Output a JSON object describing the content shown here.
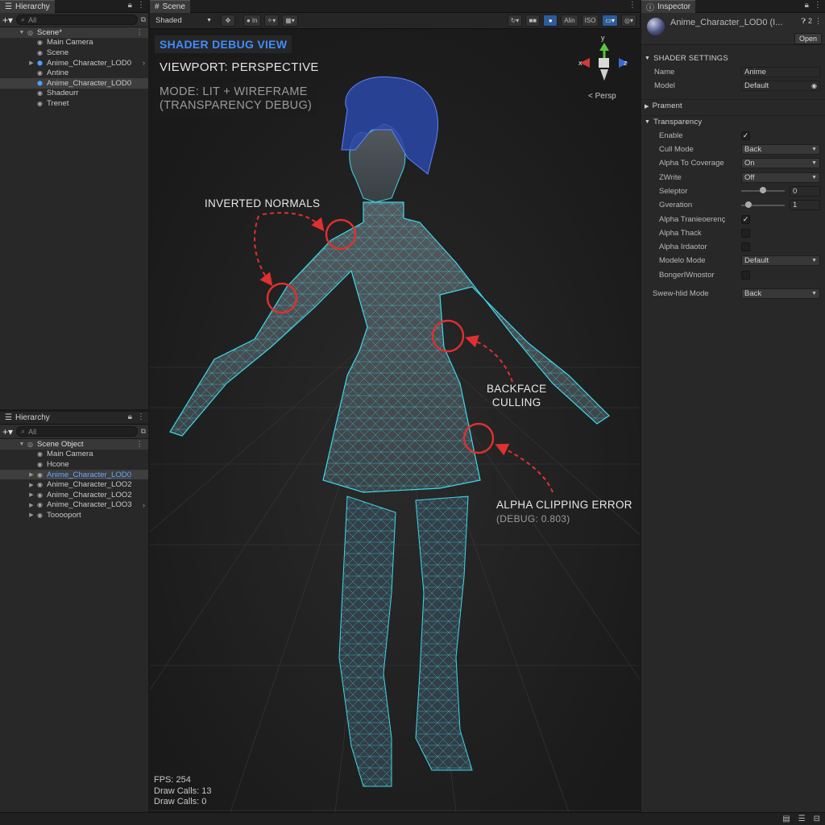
{
  "hierarchy_top": {
    "tab_label": "Hierarchy",
    "search_placeholder": "All",
    "items": [
      {
        "label": "Scene*",
        "icon": "scene-icon"
      },
      {
        "label": "Main Camera",
        "icon": "camera-icon"
      },
      {
        "label": "Scene",
        "icon": "object-icon"
      },
      {
        "label": "Anime_Character_LOD0",
        "icon": "prefab-icon"
      },
      {
        "label": "Antine",
        "icon": "object-icon"
      },
      {
        "label": "Anime_Character_LOD0",
        "icon": "prefab-icon"
      },
      {
        "label": "Shadeurr",
        "icon": "object-icon"
      },
      {
        "label": "Trenet",
        "icon": "object-icon"
      }
    ]
  },
  "hierarchy_bottom": {
    "tab_label": "Hierarchy",
    "search_placeholder": "All",
    "items": [
      {
        "label": "Scene Object",
        "icon": "scene-icon"
      },
      {
        "label": "Main Camera",
        "icon": "camera-icon"
      },
      {
        "label": "Hcone",
        "icon": "object-icon"
      },
      {
        "label": "Anime_Character_LOD0",
        "icon": "prefab-icon"
      },
      {
        "label": "Anime_Character_LOO2",
        "icon": "prefab-icon"
      },
      {
        "label": "Anime_Character_LOO2",
        "icon": "prefab-icon"
      },
      {
        "label": "Anime_Character_LOO3",
        "icon": "prefab-icon"
      },
      {
        "label": "Tooooport",
        "icon": "object-icon"
      }
    ]
  },
  "scene": {
    "tab_label": "Scene",
    "shading_mode": "Shaded",
    "toolbar": {
      "btn_2d": "Alin",
      "btn_iso": "ISO",
      "btn_in": "In"
    },
    "gizmo": {
      "x": "x",
      "y": "y",
      "z": "z",
      "persp": "< Persp"
    },
    "overlays": {
      "title": "SHADER DEBUG VIEW",
      "viewport": "VIEWPORT: PERSPECTIVE",
      "mode_line1": "MODE: LIT + WIREFRAME",
      "mode_line2": "(TRANSPARENCY DEBUG)"
    },
    "annotations": {
      "inverted_normals": "INVERTED NORMALS",
      "backface_line1": "BACKFACE",
      "backface_line2": "CULLING",
      "alpha_error": "ALPHA CLIPPING ERROR",
      "alpha_debug": "(DEBUG: 0.803)"
    },
    "stats": {
      "fps": "FPS: 254",
      "draw_calls_1": "Draw Calls: 13",
      "draw_calls_2": "Draw Calls: 0"
    },
    "colors": {
      "wireframe": "#3fd8e8",
      "annotation": "#e03030",
      "title": "#3f8cff"
    }
  },
  "inspector": {
    "tab_label": "Inspector",
    "object_name": "Anime_Character_LOD0 (I...",
    "header_badge": "2",
    "open_label": "Open",
    "shader_settings_header": "SHADER SETTINGS",
    "name_label": "Name",
    "name_value": "Anime",
    "model_label": "Model",
    "model_value": "Default",
    "prament_header": "Prament",
    "transparency_header": "Transparency",
    "props": {
      "enable_label": "Enable",
      "enable_checked": true,
      "cull_label": "Cull Mode",
      "cull_value": "Back",
      "a2c_label": "Alpha To Coverage",
      "a2c_value": "On",
      "zwrite_label": "ZWrite",
      "zwrite_value": "Off",
      "seleptor_label": "Seleptor",
      "seleptor_value": "0",
      "seleptor_level": 0.5,
      "gveration_label": "Gveration",
      "gveration_value": "1",
      "gveration_level": 0.1,
      "alpha_trans_label": "Alpha Tranieoerenç",
      "alpha_trans_checked": true,
      "alpha_thack_label": "Alpha Thack",
      "alpha_thack_checked": false,
      "alpha_irdaotor_label": "Alpha Irdaotor",
      "alpha_irdaotor_checked": false,
      "modelo_label": "Modelo Mode",
      "modelo_value": "Default",
      "bonger_label": "BongerIWnostor",
      "bonger_checked": false,
      "swew_label": "Swew-hlid Mode",
      "swew_value": "Back"
    }
  }
}
